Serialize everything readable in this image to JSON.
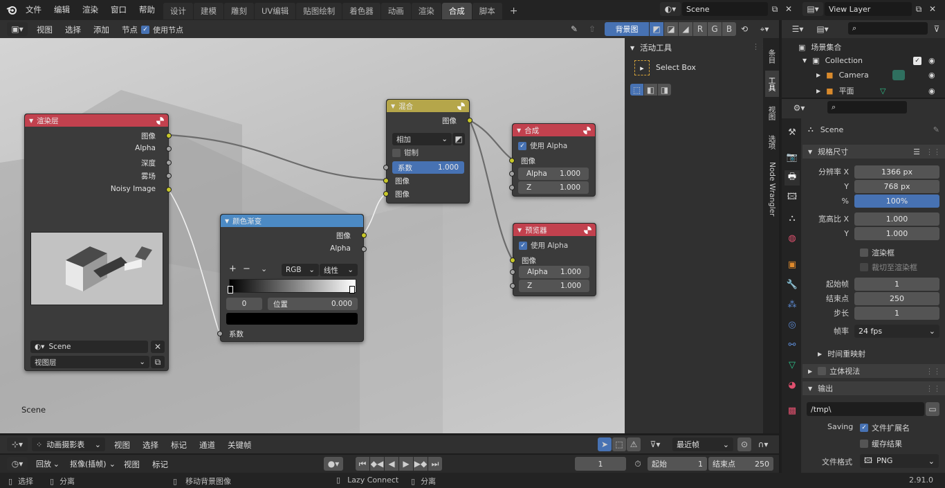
{
  "topbar": {
    "menu": [
      "文件",
      "编辑",
      "渲染",
      "窗口",
      "帮助"
    ],
    "workspaces": [
      "设计",
      "建模",
      "雕刻",
      "UV编辑",
      "贴图绘制",
      "着色器",
      "动画",
      "渲染",
      "合成",
      "脚本"
    ],
    "active_workspace": "合成",
    "scene": "Scene",
    "view_layer": "View Layer"
  },
  "node_header": {
    "menu": [
      "视图",
      "选择",
      "添加",
      "节点"
    ],
    "use_nodes_label": "使用节点",
    "backdrop_label": "背景图",
    "channels": [
      "R",
      "G",
      "B"
    ]
  },
  "sidebar": {
    "active_tool_title": "活动工具",
    "tool_name": "Select Box",
    "tabs": [
      "条目",
      "工具",
      "视图",
      "选项",
      "Node Wrangler"
    ]
  },
  "canvas": {
    "scene_label": "Scene"
  },
  "nodes": {
    "render_layers": {
      "title": "渲染层",
      "outputs": [
        "图像",
        "Alpha",
        "深度",
        "雾场",
        "Noisy Image"
      ],
      "scene": "Scene",
      "view_layer": "视图层"
    },
    "mix": {
      "title": "混合",
      "output": "图像",
      "blend_mode": "相加",
      "clamp_label": "钳制",
      "fac_label": "系数",
      "fac_value": "1.000",
      "inputs": [
        "图像",
        "图像"
      ]
    },
    "color_ramp": {
      "title": "颜色渐变",
      "outputs": [
        "图像",
        "Alpha"
      ],
      "plus": "+",
      "minus": "−",
      "color_mode": "RGB",
      "interpolation": "线性",
      "index": "0",
      "pos_label": "位置",
      "pos_value": "0.000",
      "input": "系数"
    },
    "composite": {
      "title": "合成",
      "use_alpha": "使用 Alpha",
      "input_image": "图像",
      "alpha_label": "Alpha",
      "alpha_value": "1.000",
      "z_label": "Z",
      "z_value": "1.000"
    },
    "viewer": {
      "title": "预览器",
      "use_alpha": "使用 Alpha",
      "input_image": "图像",
      "alpha_label": "Alpha",
      "alpha_value": "1.000",
      "z_label": "Z",
      "z_value": "1.000"
    }
  },
  "outliner": {
    "scene_collection": "场景集合",
    "items": [
      "Collection",
      "Camera",
      "平面"
    ]
  },
  "properties": {
    "scene": "Scene",
    "dims_title": "规格尺寸",
    "res_x_label": "分辨率 X",
    "res_x": "1366 px",
    "res_y_label": "Y",
    "res_y": "768 px",
    "pct_label": "%",
    "pct": "100%",
    "aspect_x_label": "宽高比 X",
    "aspect_x": "1.000",
    "aspect_y_label": "Y",
    "aspect_y": "1.000",
    "border_label": "渲染框",
    "crop_label": "裁切至渲染框",
    "frame_start_label": "起始帧",
    "frame_start": "1",
    "frame_end_label": "结束点",
    "frame_end": "250",
    "step_label": "步长",
    "step": "1",
    "fps_label": "帧率",
    "fps": "24 fps",
    "remap_label": "时间重映射",
    "stereo_label": "立体视法",
    "output_title": "输出",
    "output_path": "/tmp\\",
    "saving_label": "Saving",
    "file_ext_label": "文件扩展名",
    "cache_label": "缓存结果",
    "format_label": "文件格式",
    "format": "PNG"
  },
  "timeline": {
    "editor": "动画摄影表",
    "menu1": [
      "视图",
      "选择",
      "标记",
      "通道",
      "关键帧"
    ],
    "nearest_frame": "最近帧",
    "playback": "回放",
    "keying": "抠像(插帧)",
    "menu2": [
      "视图",
      "标记"
    ],
    "current_frame": "1",
    "start_label": "起始",
    "start": "1",
    "end_label": "结束点",
    "end": "250"
  },
  "statusbar": {
    "select": "选择",
    "deselect": "分离",
    "move_backdrop": "移动背景图像",
    "lazy_connect": "Lazy Connect",
    "separate": "分离",
    "version": "2.91.0"
  }
}
